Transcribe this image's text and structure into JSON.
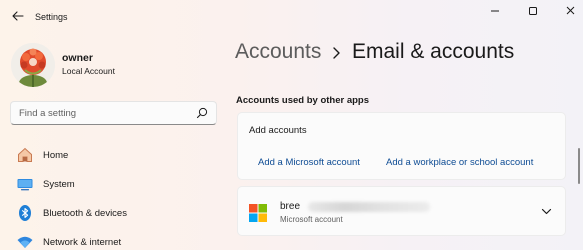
{
  "titlebar": {
    "app_title": "Settings"
  },
  "user": {
    "name": "owner",
    "account_type": "Local Account"
  },
  "search": {
    "placeholder": "Find a setting"
  },
  "sidebar": {
    "items": [
      {
        "label": "Home",
        "icon": "home-icon"
      },
      {
        "label": "System",
        "icon": "monitor-icon"
      },
      {
        "label": "Bluetooth & devices",
        "icon": "bluetooth-icon"
      },
      {
        "label": "Network & internet",
        "icon": "wifi-icon"
      }
    ]
  },
  "breadcrumb": {
    "parent": "Accounts",
    "current": "Email & accounts"
  },
  "section": {
    "header": "Accounts used by other apps"
  },
  "add_accounts": {
    "title": "Add accounts",
    "microsoft_link": "Add a Microsoft account",
    "work_link": "Add a workplace or school account"
  },
  "account": {
    "name": "bree",
    "type": "Microsoft account"
  },
  "colors": {
    "accent": "#0e4c94",
    "ms_red": "#f35325",
    "ms_green": "#81bc06",
    "ms_blue": "#05a6f0",
    "ms_yellow": "#ffba08"
  }
}
